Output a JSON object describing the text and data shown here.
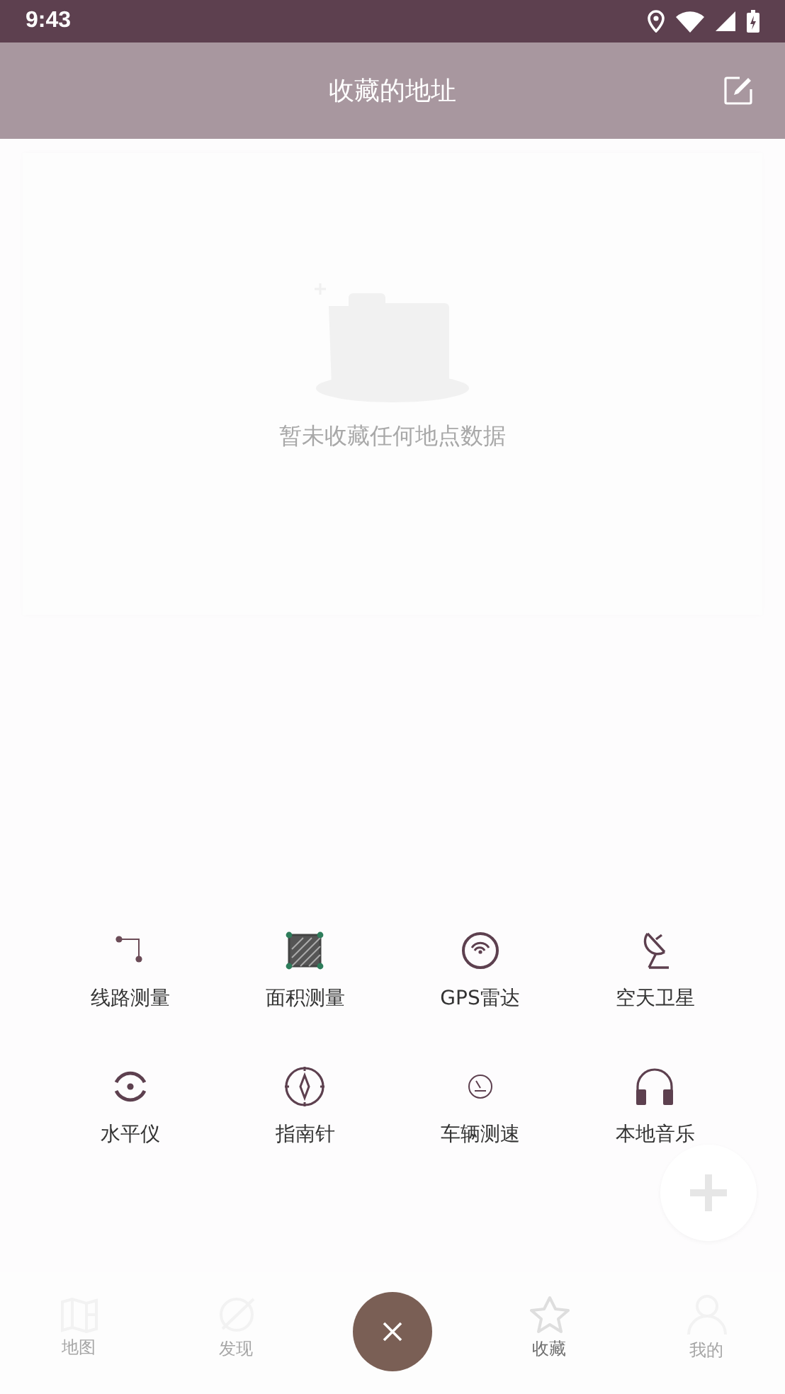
{
  "status_bar": {
    "time": "9:43"
  },
  "header": {
    "title": "收藏的地址"
  },
  "empty_state": {
    "message": "暂未收藏任何地点数据"
  },
  "tools": [
    {
      "label": "线路测量"
    },
    {
      "label": "面积测量"
    },
    {
      "label": "GPS雷达"
    },
    {
      "label": "空天卫星"
    },
    {
      "label": "水平仪"
    },
    {
      "label": "指南针"
    },
    {
      "label": "车辆测速"
    },
    {
      "label": "本地音乐"
    }
  ],
  "bottom_nav": [
    {
      "label": "地图",
      "selected": false
    },
    {
      "label": "发现",
      "selected": false
    },
    {
      "label": "收藏",
      "selected": true
    },
    {
      "label": "我的",
      "selected": false
    }
  ]
}
